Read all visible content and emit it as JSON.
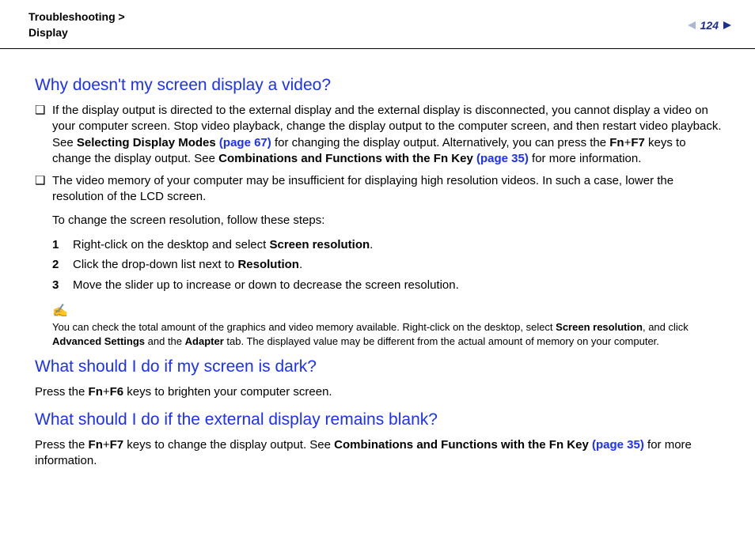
{
  "header": {
    "breadcrumb_line1": "Troubleshooting",
    "breadcrumb_chev": ">",
    "breadcrumb_line2": "Display",
    "page_number": "124"
  },
  "section1": {
    "title": "Why doesn't my screen display a video?",
    "bullets": [
      {
        "text_before": "If the display output is directed to the external display and the external display is disconnected, you cannot display a video on your computer screen. Stop video playback, change the display output to the computer screen, and then restart video playback. See ",
        "bold1": "Selecting Display Modes ",
        "link1": "(page 67)",
        "mid1": " for changing the display output. Alternatively, you can press the ",
        "bold2": "Fn",
        "plus1": "+",
        "bold3": "F7",
        "mid2": " keys to change the display output. See ",
        "bold4": "Combinations and Functions with the Fn Key ",
        "link2": "(page 35)",
        "tail": " for more information."
      },
      {
        "text": "The video memory of your computer may be insufficient for displaying high resolution videos. In such a case, lower the resolution of the LCD screen."
      }
    ],
    "follow": "To change the screen resolution, follow these steps:",
    "steps": [
      {
        "n": "1",
        "before": "Right-click on the desktop and select ",
        "bold": "Screen resolution",
        "after": "."
      },
      {
        "n": "2",
        "before": "Click the drop-down list next to ",
        "bold": "Resolution",
        "after": "."
      },
      {
        "n": "3",
        "before": "Move the slider up to increase or down to decrease the screen resolution.",
        "bold": "",
        "after": ""
      }
    ],
    "note": {
      "icon": "✍",
      "t1": "You can check the total amount of the graphics and video memory available. Right-click on the desktop, select ",
      "b1": "Screen resolution",
      "t2": ", and click ",
      "b2": "Advanced Settings",
      "t3": " and the ",
      "b3": "Adapter",
      "t4": " tab. The displayed value may be different from the actual amount of memory on your computer."
    }
  },
  "section2": {
    "title": "What should I do if my screen is dark?",
    "t1": "Press the ",
    "b1": "Fn",
    "plus": "+",
    "b2": "F6",
    "t2": " keys to brighten your computer screen."
  },
  "section3": {
    "title": "What should I do if the external display remains blank?",
    "t1": "Press the ",
    "b1": "Fn",
    "plus": "+",
    "b2": "F7",
    "t2": " keys to change the display output. See ",
    "b3": "Combinations and Functions with the Fn Key ",
    "link": "(page 35)",
    "t3": " for more information."
  }
}
